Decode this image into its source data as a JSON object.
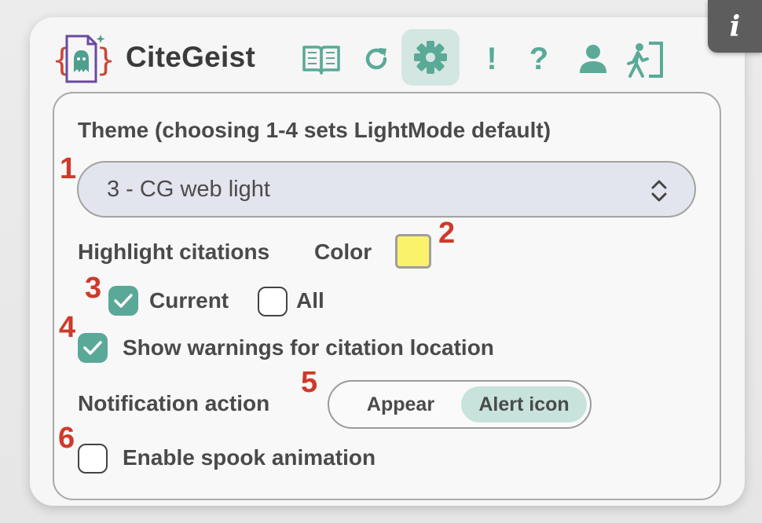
{
  "app": {
    "title": "CiteGeist"
  },
  "toolbar": {
    "icons": [
      "book-icon",
      "refresh-icon",
      "gear-icon",
      "exclamation-icon",
      "question-icon",
      "user-icon",
      "exit-icon"
    ],
    "active": "gear-icon",
    "exclamation_glyph": "!",
    "question_glyph": "?"
  },
  "info_button": {
    "glyph": "i"
  },
  "settings": {
    "theme_label": "Theme (choosing 1-4 sets LightMode default)",
    "theme_value": "3 - CG web light",
    "highlight_label": "Highlight citations",
    "color_label": "Color",
    "highlight_color": "#fbf26b",
    "current_label": "Current",
    "current_checked": true,
    "all_label": "All",
    "all_checked": false,
    "warnings_label": "Show warnings for citation location",
    "warnings_checked": true,
    "notification_label": "Notification action",
    "notification_options": [
      "Appear",
      "Alert icon"
    ],
    "notification_selected": "Alert icon",
    "spook_label": "Enable spook animation",
    "spook_checked": false
  },
  "markers": [
    "1",
    "2",
    "3",
    "4",
    "5",
    "6"
  ],
  "colors": {
    "accent": "#5aaa97",
    "marker": "#cf3a2a",
    "accent_light": "#c8e3dc"
  }
}
